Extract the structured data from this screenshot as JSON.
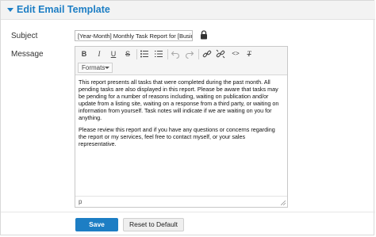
{
  "panel": {
    "title": "Edit Email Template"
  },
  "form": {
    "subject_label": "Subject",
    "subject_value": "[Year-Month] Monthly Task Report for [Business]",
    "message_label": "Message"
  },
  "editor": {
    "toolbar": {
      "bold": "B",
      "italic": "I",
      "underline": "U",
      "strike": "S",
      "code": "<>",
      "clear_format": "T",
      "formats_label": "Formats"
    },
    "paragraphs": [
      "This report presents all tasks that were completed during the past month. All pending tasks are also displayed in this report. Please be aware that tasks may be pending for a number of reasons including, waiting on publication and/or update from a listing site, waiting on a response from a third party, or waiting on information from yourself. Task notes will indicate if we are waiting on you for anything.",
      "Please review this report and if you have any questions or concerns regarding the report or my services, feel free to contact myself, or your sales representative."
    ],
    "status_path": "p"
  },
  "buttons": {
    "save": "Save",
    "reset": "Reset to Default"
  },
  "colors": {
    "accent": "#1d7ec4"
  }
}
